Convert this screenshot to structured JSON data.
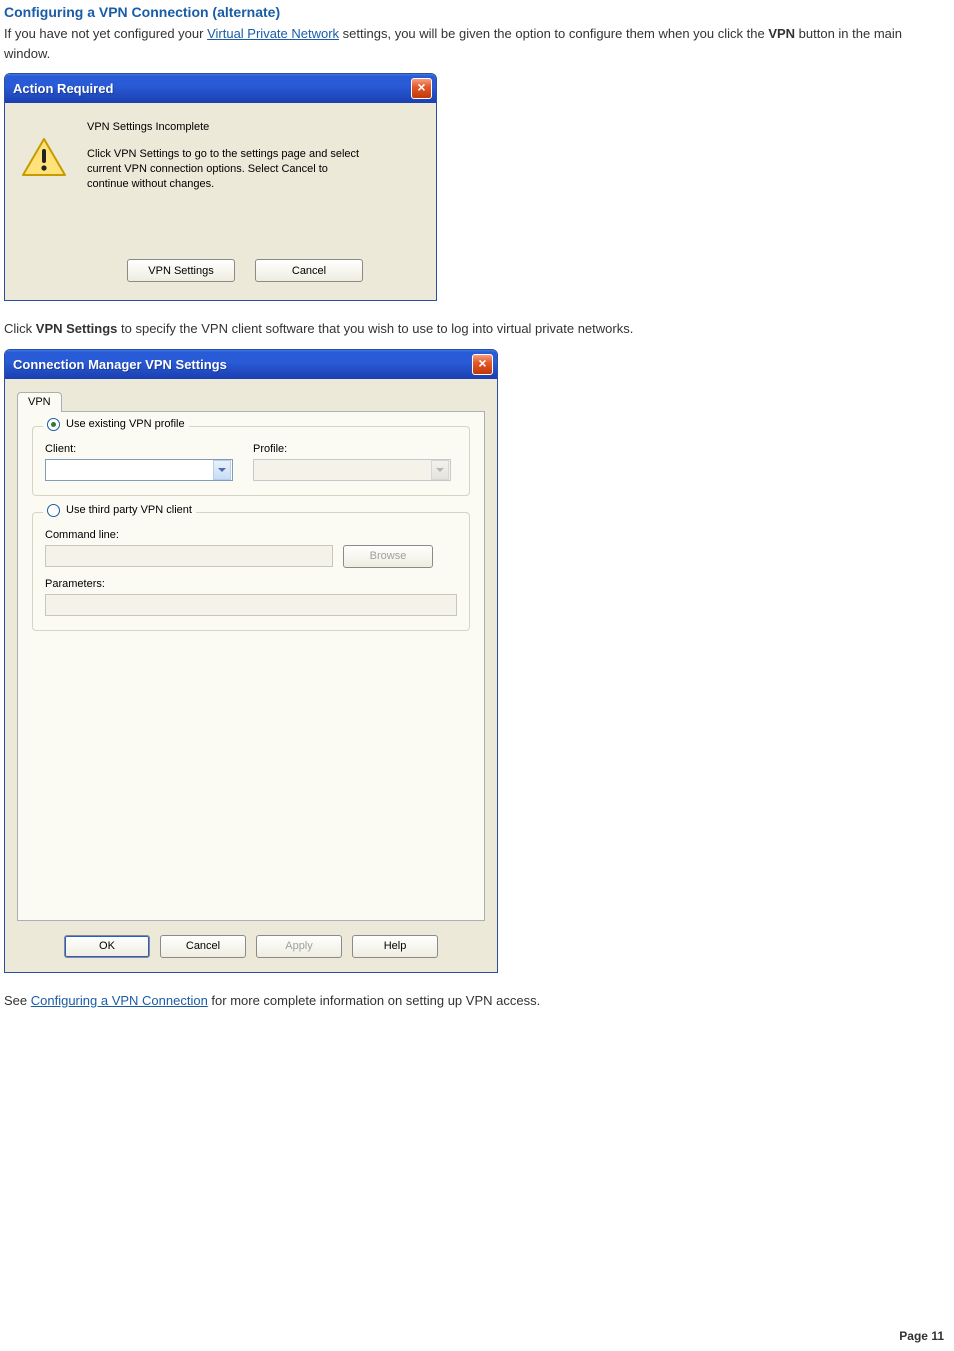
{
  "heading": "Configuring a VPN Connection (alternate)",
  "intro": {
    "pre": "If you have not yet configured your ",
    "link": "Virtual Private Network",
    "mid": " settings, you will be given the option to configure them when you click the ",
    "vpn": "VPN",
    "post": " button in the main window."
  },
  "ar": {
    "title": "Action Required",
    "line1": "VPN Settings Incomplete",
    "line2": "Click VPN Settings to go to the settings page and select current VPN connection options.  Select Cancel to continue without changes.",
    "btn_settings": "VPN Settings",
    "btn_cancel": "Cancel"
  },
  "mid_para": {
    "pre": "Click ",
    "bold": "VPN Settings",
    "post": " to specify the VPN client software that you wish to use to log into virtual private networks."
  },
  "cm": {
    "title": "Connection Manager VPN Settings",
    "tab": "VPN",
    "opt1": "Use existing VPN profile",
    "client_lbl": "Client:",
    "profile_lbl": "Profile:",
    "opt2": "Use third party VPN client",
    "cmd_lbl": "Command line:",
    "browse": "Browse",
    "params_lbl": "Parameters:",
    "ok": "OK",
    "cancel": "Cancel",
    "apply": "Apply",
    "help": "Help"
  },
  "footer": {
    "pre": "See ",
    "link": "Configuring a VPN Connection",
    "post": " for more complete information on setting up VPN access."
  },
  "page_num": "Page 11"
}
